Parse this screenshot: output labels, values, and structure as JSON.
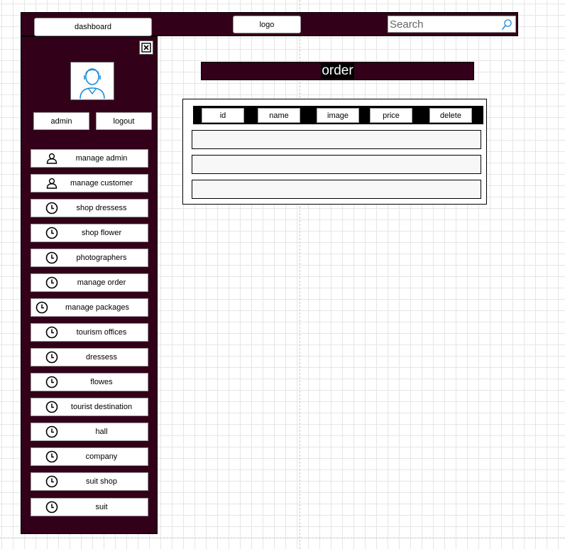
{
  "topbar": {
    "dashboard_label": "dashboard",
    "logo_label": "logo",
    "search_placeholder": "Search"
  },
  "sidebar": {
    "admin_label": "admin",
    "logout_label": "logout",
    "menu": [
      {
        "label": "manage admin",
        "icon": "user-icon"
      },
      {
        "label": "manage customer",
        "icon": "user-icon"
      },
      {
        "label": "shop dressess",
        "icon": "clock-icon"
      },
      {
        "label": "shop flower",
        "icon": "clock-icon"
      },
      {
        "label": "photographers",
        "icon": "clock-icon"
      },
      {
        "label": "manage order",
        "icon": "clock-icon"
      },
      {
        "label": "manage packages",
        "icon": "clock-icon"
      },
      {
        "label": "tourism offices",
        "icon": "clock-icon"
      },
      {
        "label": "dressess",
        "icon": "clock-icon"
      },
      {
        "label": "flowes",
        "icon": "clock-icon"
      },
      {
        "label": "tourist destination",
        "icon": "clock-icon"
      },
      {
        "label": "hall",
        "icon": "clock-icon"
      },
      {
        "label": "company",
        "icon": "clock-icon"
      },
      {
        "label": "suit shop",
        "icon": "clock-icon"
      },
      {
        "label": "suit",
        "icon": "clock-icon"
      }
    ]
  },
  "main": {
    "title": "order",
    "columns": [
      "id",
      "name",
      "image",
      "price",
      "delete"
    ],
    "rows": [
      {},
      {},
      {}
    ]
  },
  "colors": {
    "panel_bg": "#33001a",
    "accent": "#000000",
    "icon_blue": "#1a8cd8"
  }
}
